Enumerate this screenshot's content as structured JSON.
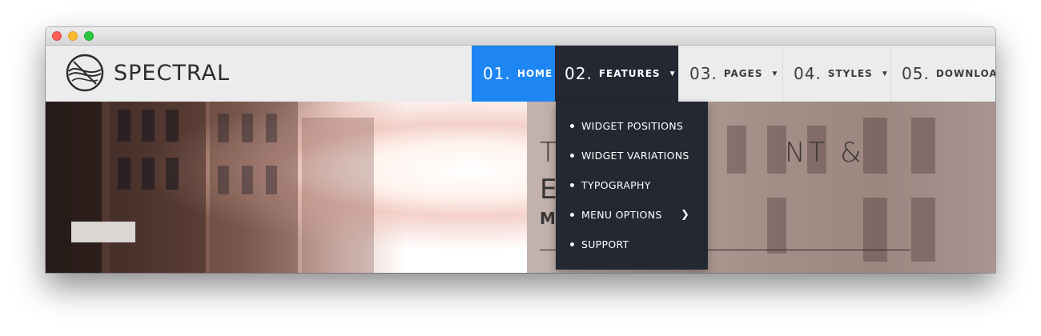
{
  "window": {
    "buttons": [
      "close",
      "minimize",
      "maximize"
    ]
  },
  "brand": {
    "name": "SPECTRAL",
    "logo_icon": "spectral-logo-icon"
  },
  "nav": {
    "items": [
      {
        "num": "01.",
        "label": "HOME",
        "has_dropdown": false,
        "state": "active"
      },
      {
        "num": "02.",
        "label": "FEATURES",
        "has_dropdown": true,
        "state": "open"
      },
      {
        "num": "03.",
        "label": "PAGES",
        "has_dropdown": true
      },
      {
        "num": "04.",
        "label": "STYLES",
        "has_dropdown": true
      },
      {
        "num": "05.",
        "label": "DOWNLOAD",
        "has_dropdown": false
      }
    ]
  },
  "dropdown": {
    "items": [
      {
        "label": "WIDGET POSITIONS",
        "submenu": false
      },
      {
        "label": "WIDGET VARIATIONS",
        "submenu": false
      },
      {
        "label": "TYPOGRAPHY",
        "submenu": false
      },
      {
        "label": "MENU OPTIONS",
        "submenu": true
      },
      {
        "label": "SUPPORT",
        "submenu": false
      }
    ]
  },
  "hero": {
    "line1_visible_start": "T",
    "line1_visible_end": "NT &",
    "line2_visible_start": "E",
    "line3_visible_start": "M"
  },
  "colors": {
    "accent": "#1e86f2",
    "menu_bg": "#242832",
    "header_bg": "#ececec"
  }
}
